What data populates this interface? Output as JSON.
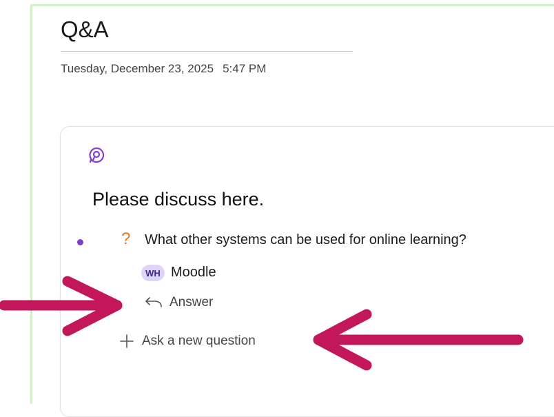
{
  "page": {
    "title": "Q&A",
    "date": "Tuesday, December 23, 2025",
    "time": "5:47 PM"
  },
  "card": {
    "heading": "Please discuss here.",
    "question": {
      "marker": "?",
      "text": "What other systems can be used for online learning?"
    },
    "reply": {
      "avatar_initials": "WH",
      "text": "Moodle"
    },
    "answer_label": "Answer",
    "ask_label": "Ask a new question"
  },
  "colors": {
    "frame": "#d4f0c8",
    "accent_purple": "#7a3fc4",
    "question_orange": "#e8742a",
    "arrow": "#c2185b"
  },
  "icons": {
    "card": "loop-component-icon",
    "answer": "reply-arrow-icon",
    "ask": "plus-icon"
  }
}
